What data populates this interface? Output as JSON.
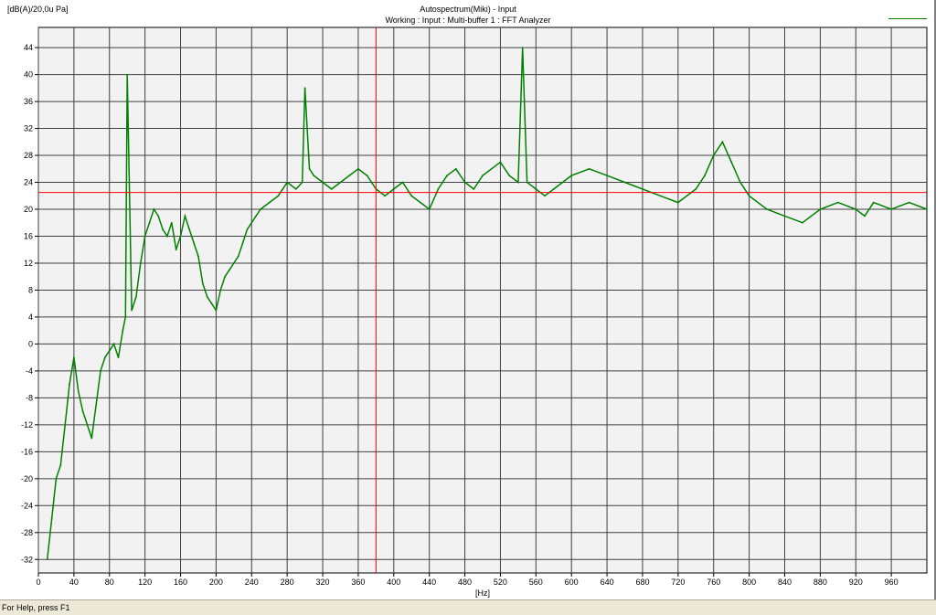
{
  "status_bar": {
    "text": "For Help, press F1"
  },
  "colors": {
    "series": "#008000",
    "cursor": "#ff0000",
    "grid": "#404040",
    "plot_bg": "#f2f2f2"
  },
  "chart_data": {
    "type": "line",
    "title": "Autospectrum(Miki) - Input",
    "subtitle": "Working : Input : Multi-buffer 1 : FFT Analyzer",
    "ylabel": "[dB(A)/20,0u Pa]",
    "xlabel": "[Hz]",
    "xlim": [
      0,
      1000
    ],
    "ylim": [
      -34,
      47
    ],
    "x_ticks": [
      0,
      40,
      80,
      120,
      160,
      200,
      240,
      280,
      320,
      360,
      400,
      440,
      480,
      520,
      560,
      600,
      640,
      680,
      720,
      760,
      800,
      840,
      880,
      920,
      960
    ],
    "y_ticks": [
      44,
      40,
      36,
      32,
      28,
      24,
      20,
      16,
      12,
      8,
      4,
      0,
      -4,
      -8,
      -12,
      -16,
      -20,
      -24,
      -28,
      -32
    ],
    "grid": true,
    "legend": "top-right",
    "cursor": {
      "x": 380,
      "y": 22.5
    },
    "series": [
      {
        "x": [
          10,
          15,
          20,
          25,
          30,
          35,
          40,
          45,
          50,
          55,
          60,
          65,
          70,
          75,
          80,
          85,
          90,
          95,
          98,
          100,
          105,
          110,
          115,
          120,
          125,
          130,
          135,
          140,
          145,
          150,
          155,
          160,
          165,
          170,
          175,
          180,
          185,
          190,
          195,
          200,
          205,
          210,
          215,
          220,
          225,
          230,
          235,
          240,
          245,
          250,
          260,
          270,
          280,
          290,
          297,
          300,
          305,
          310,
          320,
          330,
          340,
          350,
          360,
          370,
          380,
          390,
          400,
          410,
          420,
          430,
          440,
          450,
          460,
          470,
          480,
          490,
          500,
          510,
          520,
          530,
          540,
          545,
          550,
          560,
          570,
          580,
          590,
          600,
          620,
          640,
          660,
          680,
          700,
          720,
          740,
          750,
          760,
          770,
          780,
          790,
          800,
          820,
          840,
          860,
          880,
          900,
          920,
          930,
          940,
          960,
          980,
          1000
        ],
        "values": [
          -32,
          -26,
          -20,
          -18,
          -12,
          -6,
          -2,
          -7,
          -10,
          -12,
          -14,
          -9,
          -4,
          -2,
          -1,
          0,
          -2,
          2,
          4,
          40,
          5,
          7,
          12,
          16,
          18,
          20,
          19,
          17,
          16,
          18,
          14,
          16,
          19,
          17,
          15,
          13,
          9,
          7,
          6,
          5,
          8,
          10,
          11,
          12,
          13,
          15,
          17,
          18,
          19,
          20,
          21,
          22,
          24,
          23,
          24,
          38,
          26,
          25,
          24,
          23,
          24,
          25,
          26,
          25,
          23,
          22,
          23,
          24,
          22,
          21,
          20,
          23,
          25,
          26,
          24,
          23,
          25,
          26,
          27,
          25,
          24,
          44,
          24,
          23,
          22,
          23,
          24,
          25,
          26,
          25,
          24,
          23,
          22,
          21,
          23,
          25,
          28,
          30,
          27,
          24,
          22,
          20,
          19,
          18,
          20,
          21,
          20,
          19,
          21,
          20,
          21,
          20
        ]
      }
    ]
  }
}
